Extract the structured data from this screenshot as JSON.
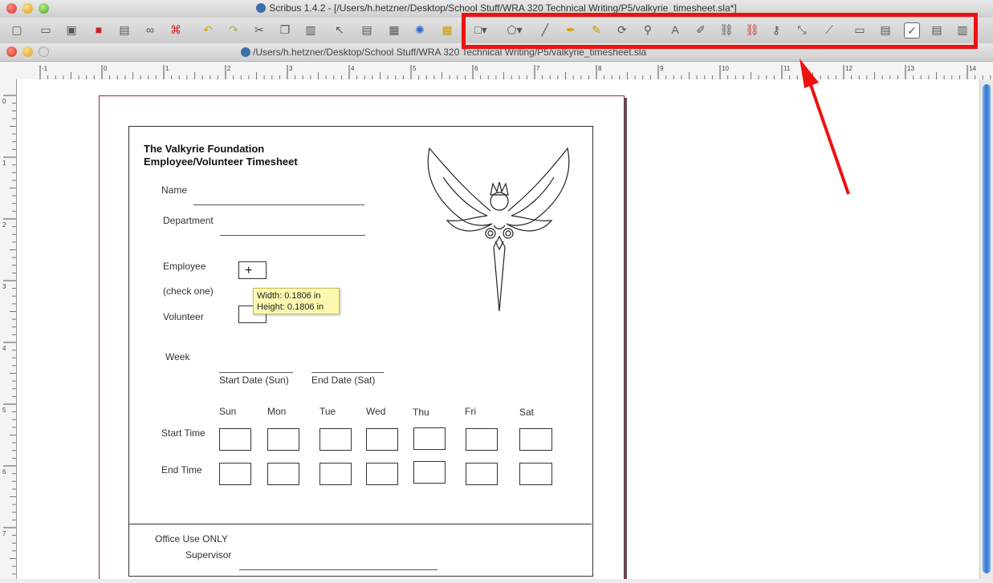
{
  "window": {
    "title": "Scribus 1.4.2 - [/Users/h.hetzner/Desktop/School Stuff/WRA 320 Technical Writing/P5/valkyrie_timesheet.sla*]",
    "doc_path": "/Users/h.hetzner/Desktop/School Stuff/WRA 320 Technical Writing/P5/valkyrie_timesheet.sla"
  },
  "toolbar": {
    "icons": [
      "new-icon",
      "open-icon",
      "save-icon",
      "close-icon",
      "print-icon",
      "preflight-icon",
      "pdf-icon",
      "undo-icon",
      "redo-icon",
      "cut-icon",
      "copy-icon",
      "paste-icon",
      "select-icon",
      "text-frame-icon",
      "image-frame-icon",
      "render-frame-icon",
      "table-icon",
      "shape-icon",
      "polygon-icon",
      "line-icon",
      "bezier-icon",
      "freehand-icon",
      "rotate-icon",
      "zoom-icon",
      "edit-contents-icon",
      "edit-text-icon",
      "link-frames-icon",
      "unlink-frames-icon",
      "measure-icon",
      "copy-properties-icon",
      "eyedropper-icon",
      "pdf-push-button-icon",
      "pdf-text-field-icon",
      "pdf-checkbox-icon",
      "pdf-combo-box-icon",
      "pdf-list-box-icon"
    ]
  },
  "document": {
    "org": "The Valkyrie Foundation",
    "form_title": "Employee/Volunteer Timesheet",
    "name_label": "Name",
    "department_label": "Department",
    "employee_label": "Employee",
    "check_one_label": "(check one)",
    "volunteer_label": "Volunteer",
    "week_label": "Week",
    "start_date_label": "Start Date (Sun)",
    "end_date_label": "End Date (Sat)",
    "days": [
      "Sun",
      "Mon",
      "Tue",
      "Wed",
      "Thu",
      "Fri",
      "Sat"
    ],
    "start_time_label": "Start Time",
    "end_time_label": "End Time",
    "office_use_label": "Office Use ONLY",
    "supervisor_label": "Supervisor"
  },
  "tooltip": {
    "width": "Width: 0.1806 in",
    "height": "Height: 0.1806 in"
  },
  "ruler": {
    "top_labels": [
      "-1",
      "0",
      "1",
      "2",
      "3",
      "4",
      "5",
      "6",
      "7",
      "8",
      "9",
      "10",
      "11",
      "12",
      "13",
      "14"
    ],
    "left_labels": [
      "0",
      "1",
      "2",
      "3",
      "4",
      "5",
      "6",
      "7"
    ]
  },
  "colors": {
    "highlight": "#ee1111",
    "accent": "#2f75d2"
  }
}
